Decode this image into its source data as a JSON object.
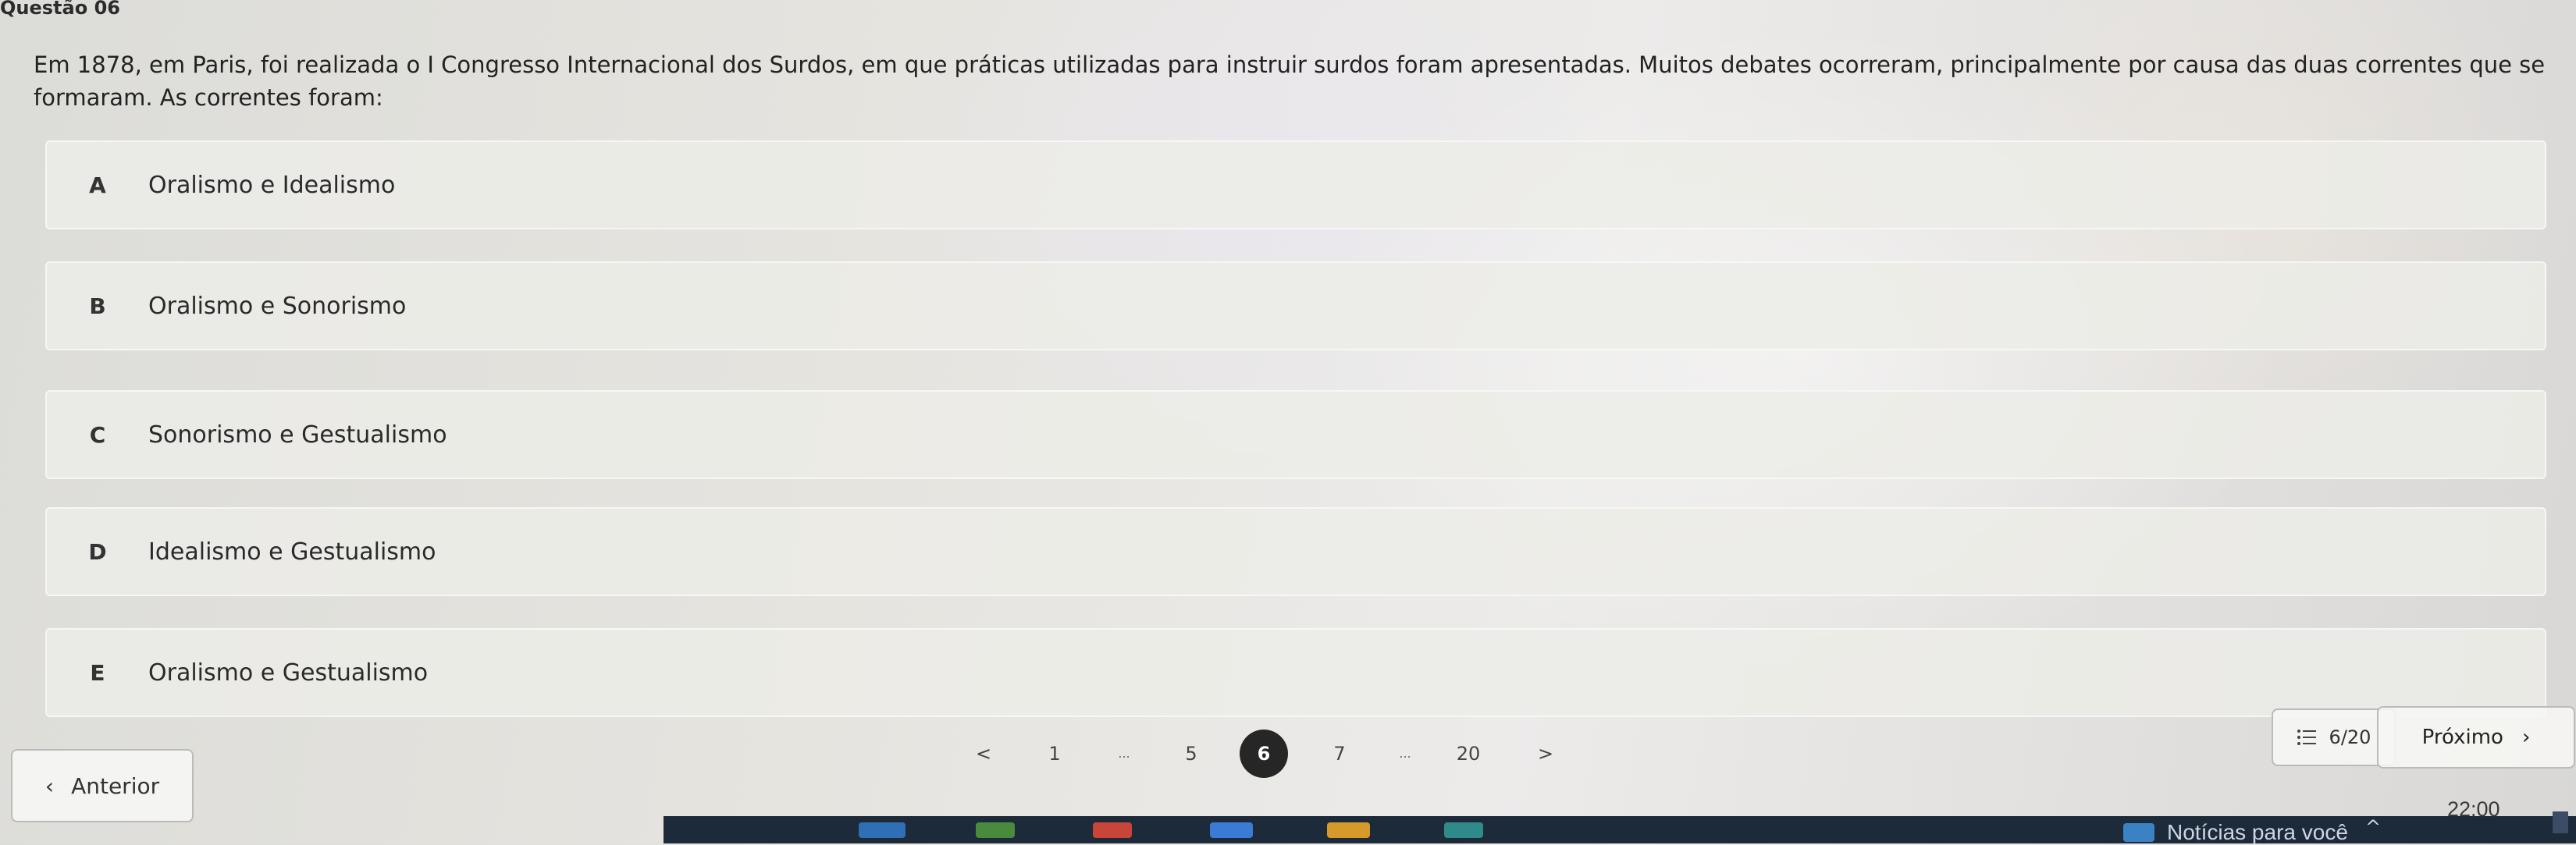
{
  "question": {
    "number_label": "Questão 06",
    "text": "Em 1878, em Paris, foi realizada o I Congresso Internacional dos Surdos, em que práticas utilizadas para instruir surdos foram apresentadas. Muitos debates ocorreram, principalmente por causa das duas correntes que se formaram. As correntes foram:"
  },
  "options": [
    {
      "letter": "A",
      "text": "Oralismo e Idealismo"
    },
    {
      "letter": "B",
      "text": "Oralismo e Sonorismo"
    },
    {
      "letter": "C",
      "text": "Sonorismo e Gestualismo"
    },
    {
      "letter": "D",
      "text": "Idealismo e Gestualismo"
    },
    {
      "letter": "E",
      "text": "Oralismo e Gestualismo"
    }
  ],
  "navigation": {
    "previous_label": "Anterior",
    "next_label": "Próximo",
    "prev_arrow": "‹",
    "next_arrow": "›",
    "pagination": {
      "prev": "<",
      "pages": [
        "1",
        "...",
        "5",
        "6",
        "7",
        "...",
        "20"
      ],
      "current": "6",
      "next": ">"
    },
    "counter": "6/20"
  },
  "taskbar": {
    "news_label": "Notícias para você",
    "time": "22:00",
    "chevron": "^"
  },
  "colors": {
    "current_page_bg": "#262626",
    "taskbar_bg": "#1d2a3a",
    "accent_blue": "#3b82c4"
  }
}
